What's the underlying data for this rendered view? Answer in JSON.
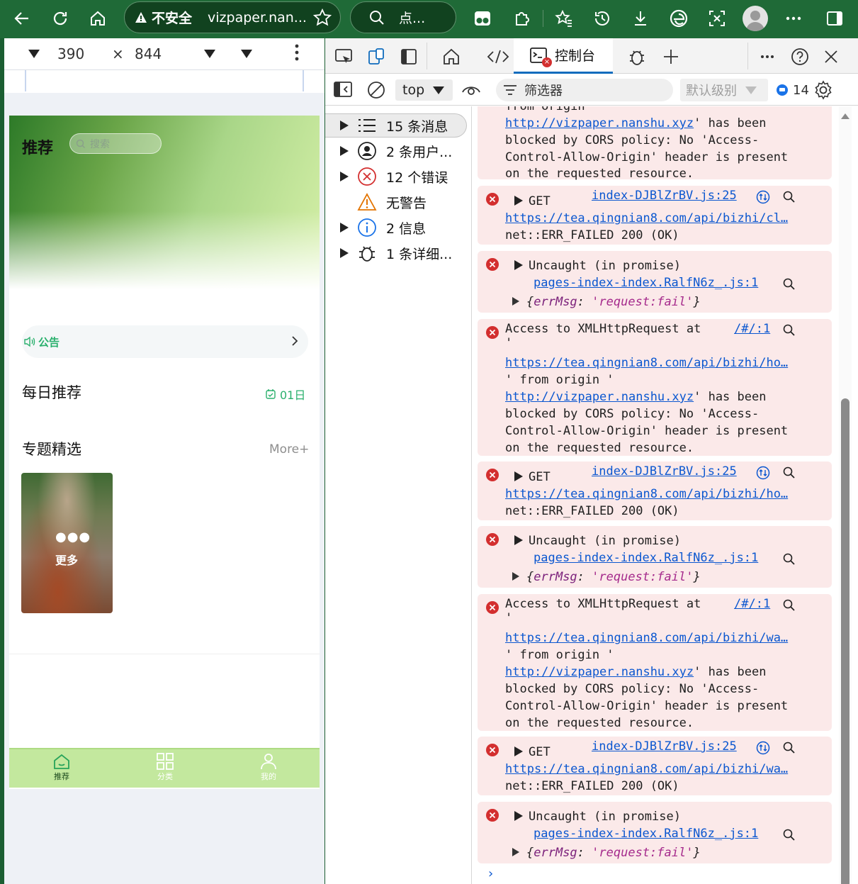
{
  "browser": {
    "security_label": "不安全",
    "url": "vizpaper.nan...",
    "search_text": "点..."
  },
  "device": {
    "width": "390",
    "height": "844",
    "times": "×"
  },
  "app": {
    "title": "推荐",
    "search_placeholder": "搜索",
    "notice_label": "公告",
    "daily_title": "每日推荐",
    "daily_badge": "01日",
    "topics_title": "专题精选",
    "more_label": "More+",
    "card_dots": "●●●",
    "card_label": "更多",
    "tabs": [
      {
        "label": "推荐",
        "icon": "home-icon",
        "active": true
      },
      {
        "label": "分类",
        "icon": "grid-icon",
        "active": false
      },
      {
        "label": "我的",
        "icon": "user-icon",
        "active": false
      }
    ]
  },
  "devtools": {
    "active_tab": "控制台",
    "context": "top",
    "filter_placeholder": "筛选器",
    "level": "默认级别",
    "issues_count": "14",
    "sidebar": [
      {
        "label": "15 条消息",
        "icon": "list-icon"
      },
      {
        "label": "2 条用户...",
        "icon": "user-circle-icon"
      },
      {
        "label": "12 个错误",
        "icon": "error-icon"
      },
      {
        "label": "无警告",
        "icon": "warning-icon"
      },
      {
        "label": "2 信息",
        "icon": "info-icon"
      },
      {
        "label": "1 条详细...",
        "icon": "bug-icon"
      }
    ],
    "log": {
      "e0": {
        "l0": "from origin '",
        "l1_link": "http://vizpaper.nanshu.xyz",
        "l1_rest": "' has been",
        "l2": "blocked by CORS policy: No 'Access-",
        "l3": "Control-Allow-Origin' header is present",
        "l4": "on the requested resource."
      },
      "get_label": "GET",
      "get_source": "index-DJBlZrBV.js:25",
      "net_failed": "net::ERR_FAILED 200 (OK)",
      "uncaught": "Uncaught (in promise)",
      "uncaught_source": "pages-index-index.RalfN6z_.js:1",
      "errmsg_open": "{",
      "errmsg_key": "errMsg",
      "errmsg_sep": ": ",
      "errmsg_val": "'request:fail'",
      "errmsg_close": "}",
      "cors_prefix": "Access to XMLHttpRequest at",
      "cors_source": "/#/:1",
      "quote": "'",
      "from_origin": "' from origin '",
      "origin_link": "http://vizpaper.nanshu.xyz",
      "has_been": "' has been",
      "blocked": "blocked by CORS policy: No 'Access-",
      "control": "Control-Allow-Origin' header is present",
      "requested": "on the requested resource.",
      "url_cl": "https://tea.qingnian8.com/api/bizhi/cl…",
      "url_ho": "https://tea.qingnian8.com/api/bizhi/ho…",
      "url_wa": "https://tea.qingnian8.com/api/bizhi/wa…",
      "prompt": "›"
    }
  }
}
